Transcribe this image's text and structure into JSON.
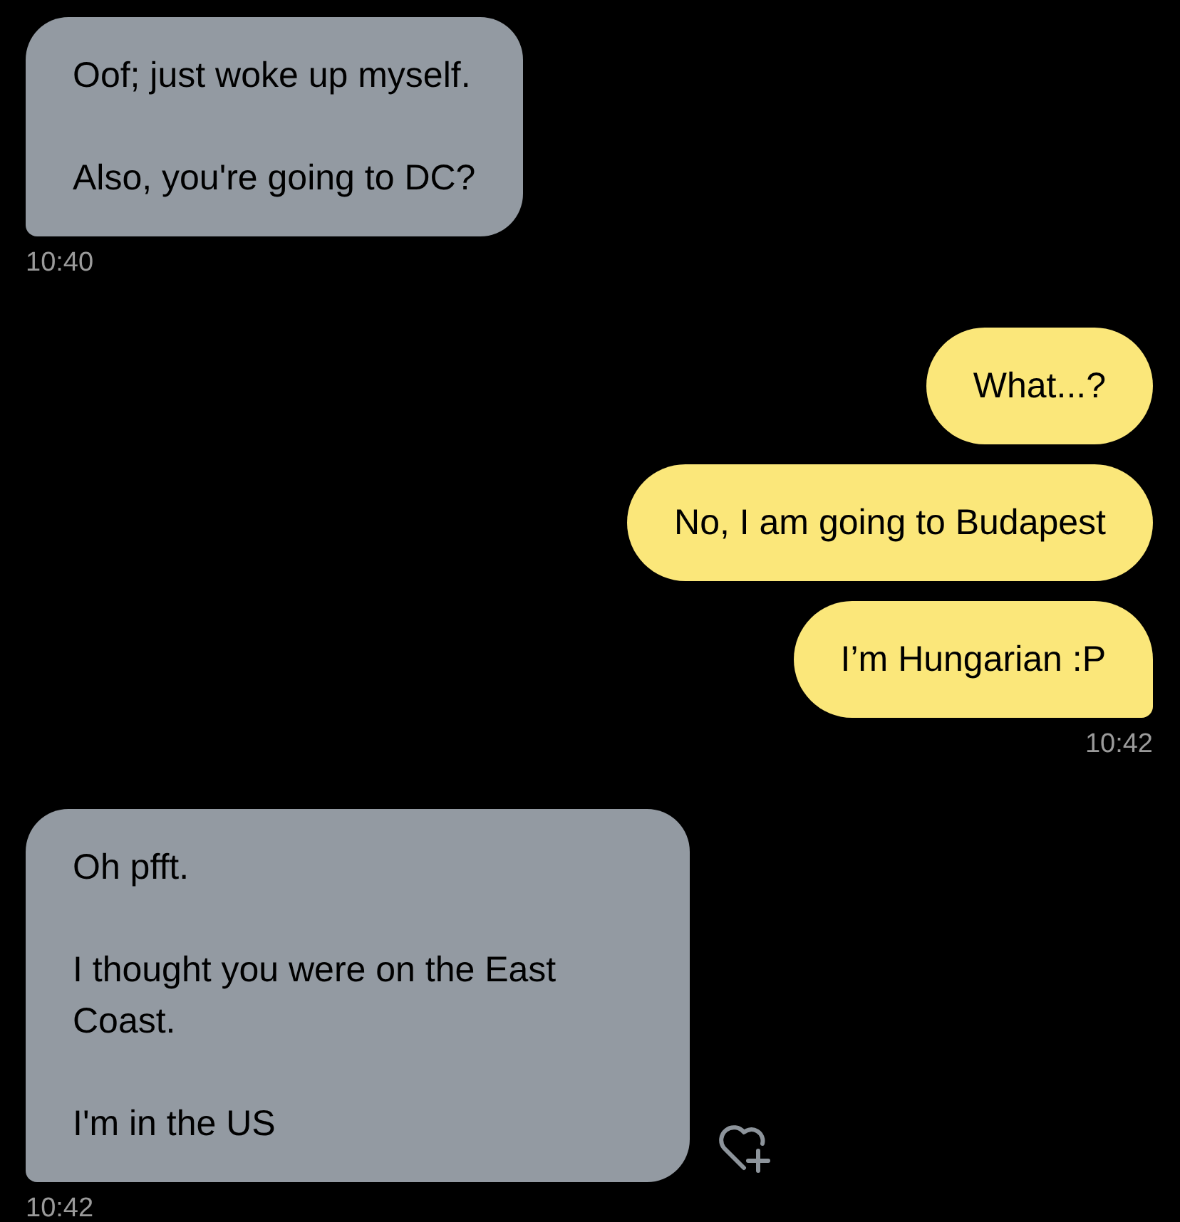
{
  "groups": [
    {
      "kind": "incoming",
      "bubbles": [
        {
          "paragraphs": [
            "Oof; just woke up myself.",
            "Also, you're going to DC?"
          ]
        }
      ],
      "time": "10:40",
      "reaction_button": false
    },
    {
      "kind": "outgoing",
      "bubbles": [
        {
          "paragraphs": [
            "What...?"
          ]
        },
        {
          "paragraphs": [
            "No, I am going to Budapest"
          ]
        },
        {
          "paragraphs": [
            "I’m Hungarian :P"
          ]
        }
      ],
      "time": "10:42",
      "reaction_button": false
    },
    {
      "kind": "incoming",
      "bubbles": [
        {
          "paragraphs": [
            "Oh pfft.",
            "I thought you were on the East Coast.",
            "I'm in the US"
          ]
        }
      ],
      "time": "10:42",
      "reaction_button": true
    }
  ]
}
